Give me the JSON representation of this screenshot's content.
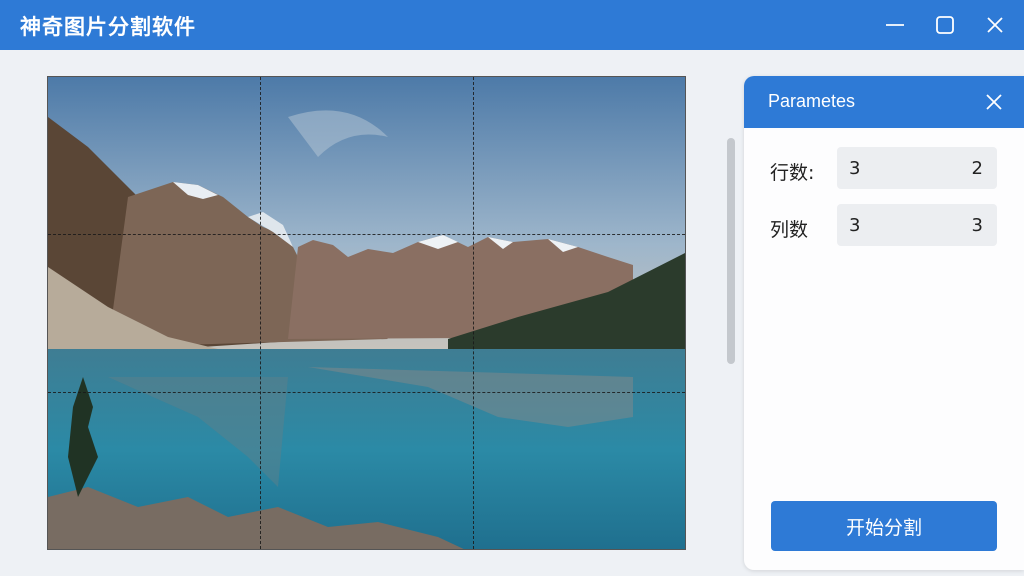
{
  "window": {
    "title": "神奇图片分割软件",
    "icons": {
      "minimize": "minimize-icon",
      "maximize": "maximize-icon",
      "close": "close-icon"
    }
  },
  "preview": {
    "grid_rows": 3,
    "grid_cols": 3,
    "image_subject": "mountain-lake-landscape"
  },
  "panel": {
    "title": "Parametes",
    "rows_label": "行数:",
    "rows_value": "3",
    "rows_value_right": "2",
    "cols_label": "列数",
    "cols_value": "3",
    "cols_value_right": "3",
    "start_button": "开始分割"
  },
  "colors": {
    "accent": "#2e7ad6",
    "background": "#eef1f5",
    "field": "#eceef1"
  }
}
